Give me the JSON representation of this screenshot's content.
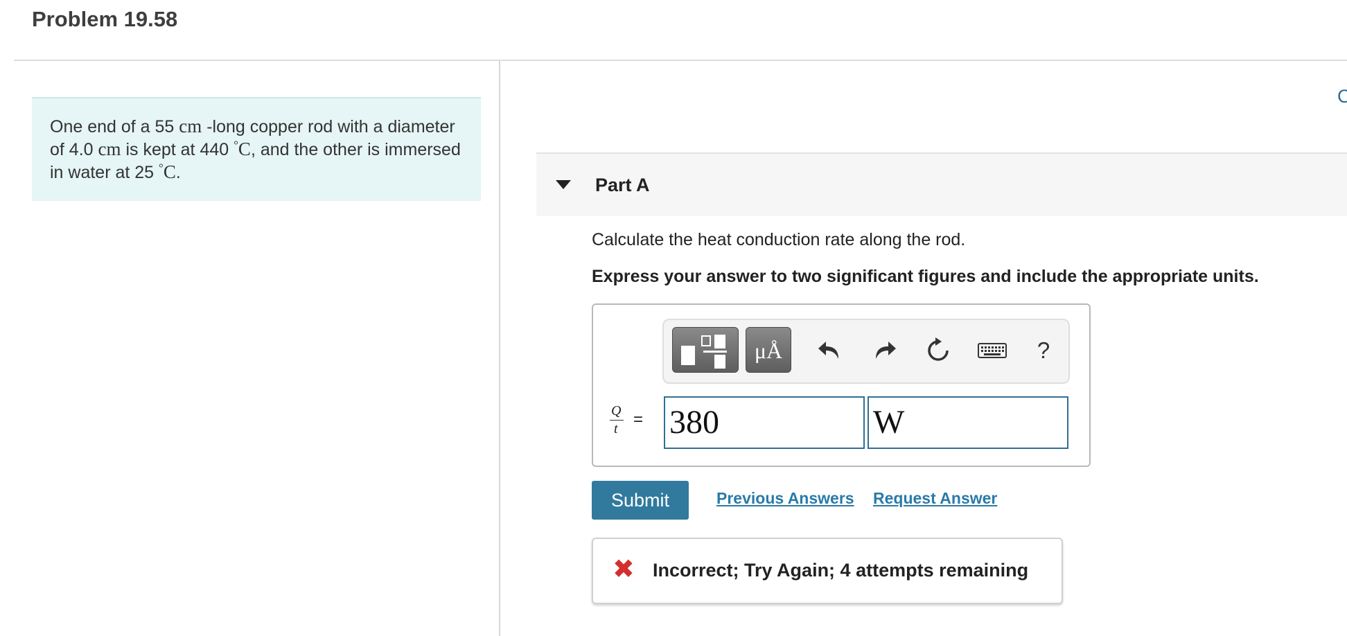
{
  "page": {
    "title": "Problem 19.58"
  },
  "problem": {
    "text_1": "One end of a 55 ",
    "unit_cm_1": "cm",
    "text_2": " -long copper rod with a diameter of 4.0 ",
    "unit_cm_2": "cm",
    "text_3": " is kept at 440 ",
    "deg_1": "°",
    "unit_c_1": "C",
    "text_4": ", and the other is immersed in water at 25 ",
    "deg_2": "°",
    "unit_c_2": "C",
    "text_5": "."
  },
  "corner_link": "C",
  "part": {
    "label": "Part A",
    "question": "Calculate the heat conduction rate along the rod.",
    "instruction": "Express your answer to two significant figures and include the appropriate units."
  },
  "toolbar": {
    "units_label": "μÅ",
    "help_label": "?",
    "icons": [
      "templates-icon",
      "units-icon",
      "undo-icon",
      "redo-icon",
      "reset-icon",
      "keyboard-icon",
      "help-icon"
    ]
  },
  "answer": {
    "lhs_numerator": "Q",
    "lhs_denominator": "t",
    "equals": "=",
    "value": "380",
    "unit": "W"
  },
  "actions": {
    "submit_label": "Submit",
    "previous_answers_label": "Previous Answers",
    "request_answer_label": "Request Answer"
  },
  "feedback": {
    "icon": "x-icon",
    "message": "Incorrect; Try Again; 4 attempts remaining",
    "color": "#d42f2f"
  },
  "colors": {
    "accent": "#317a9e",
    "problem_bg": "#e6f5f5",
    "link": "#2a7aa8"
  }
}
